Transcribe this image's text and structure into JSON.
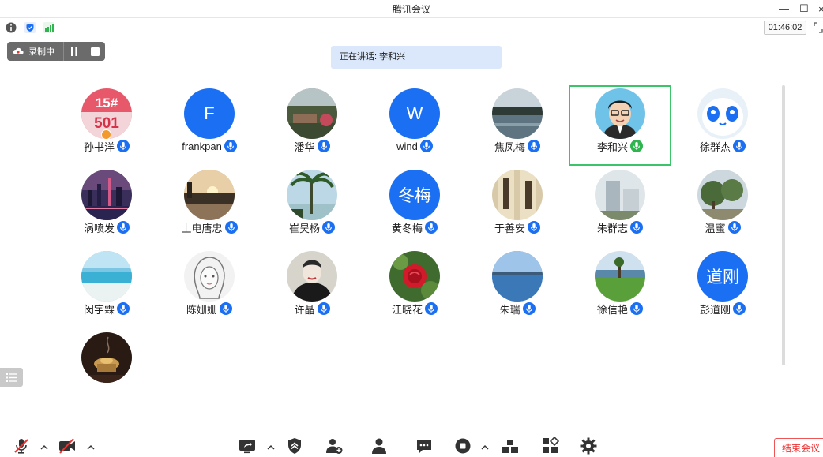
{
  "window": {
    "title": "腾讯会议",
    "minimize": "—",
    "maximize": "☐",
    "close": "×"
  },
  "infobar": {
    "timer": "01:46:02",
    "icons": [
      "info-icon",
      "shield-icon",
      "signal-icon"
    ]
  },
  "recording": {
    "label": "录制中"
  },
  "speaking": {
    "text": "正在讲话: 李和兴"
  },
  "participants": [
    {
      "name": "孙书洋",
      "avatar": "image-15-501",
      "badge_text": [
        "15#",
        "501"
      ],
      "host": true
    },
    {
      "name": "frankpan",
      "avatar": "letter",
      "letter": "F"
    },
    {
      "name": "潘华",
      "avatar": "photo-garden"
    },
    {
      "name": "wind",
      "avatar": "letter",
      "letter": "W"
    },
    {
      "name": "焦凤梅",
      "avatar": "photo-lake-dusk"
    },
    {
      "name": "李和兴",
      "avatar": "cartoon-man",
      "active": true,
      "speaking": true
    },
    {
      "name": "徐群杰",
      "avatar": "cartoon-robot"
    },
    {
      "name": "涡喷发",
      "avatar": "photo-city-night"
    },
    {
      "name": "上电唐忠",
      "avatar": "photo-sunset"
    },
    {
      "name": "崔昊杨",
      "avatar": "photo-palm-beach"
    },
    {
      "name": "黄冬梅",
      "avatar": "letter",
      "letter": "冬梅"
    },
    {
      "name": "于善安",
      "avatar": "photo-calligraphy"
    },
    {
      "name": "朱群志",
      "avatar": "photo-building"
    },
    {
      "name": "温蜜",
      "avatar": "photo-trees"
    },
    {
      "name": "闵宇霖",
      "avatar": "photo-sea-beach"
    },
    {
      "name": "陈姗姗",
      "avatar": "sketch-woman"
    },
    {
      "name": "许晶",
      "avatar": "photo-portrait"
    },
    {
      "name": "江晓花",
      "avatar": "photo-rose"
    },
    {
      "name": "朱瑞",
      "avatar": "photo-blue-lake"
    },
    {
      "name": "徐信艳",
      "avatar": "photo-lawn-lake"
    },
    {
      "name": "彭道刚",
      "avatar": "letter",
      "letter": "道刚"
    },
    {
      "name": "",
      "avatar": "photo-incense-burner"
    }
  ],
  "toolbar": {
    "items": [
      "mute-mic-icon",
      "video-off-icon",
      "share-screen-icon",
      "security-icon",
      "invite-icon",
      "members-icon",
      "chat-icon",
      "record-icon",
      "layout-icon",
      "apps-icon",
      "settings-icon"
    ],
    "end_label": "结束会议"
  },
  "colors": {
    "accent": "#1b6ff2",
    "active_border": "#3cc46b",
    "speaking_bg": "#dbe8fb",
    "end": "#e33333"
  }
}
